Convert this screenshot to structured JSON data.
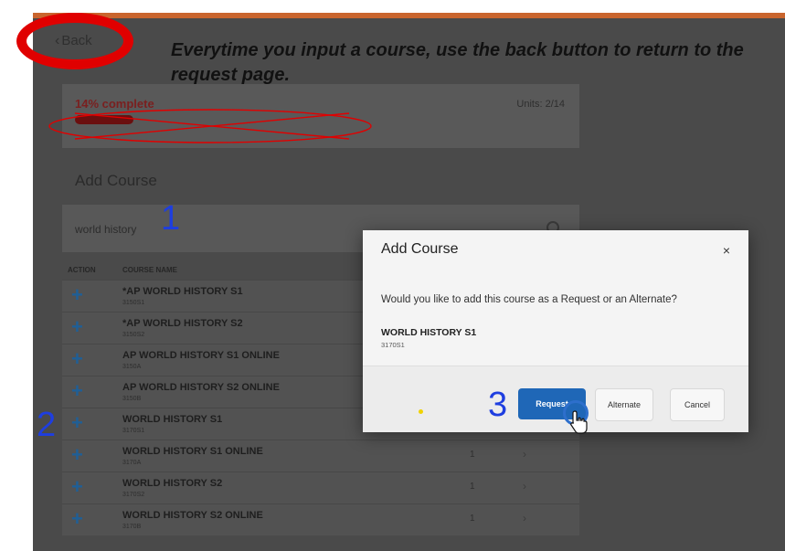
{
  "instruction_text": "Everytime you input a course, use the back button to return to the request page.",
  "header": {
    "back_label": "Back"
  },
  "progress": {
    "label": "14% complete",
    "percent": 14,
    "units_label": "Units: 2/14"
  },
  "add_course": {
    "title": "Add Course",
    "search_value": "world history"
  },
  "table": {
    "headers": {
      "action": "ACTION",
      "course_name": "COURSE NAME"
    },
    "rows": [
      {
        "name": "*AP WORLD HISTORY S1",
        "code": "3150S1",
        "units": "",
        "chevron": false
      },
      {
        "name": "*AP WORLD HISTORY S2",
        "code": "3150S2",
        "units": "",
        "chevron": false
      },
      {
        "name": "AP WORLD HISTORY S1 ONLINE",
        "code": "3150A",
        "units": "",
        "chevron": false
      },
      {
        "name": "AP WORLD HISTORY S2 ONLINE",
        "code": "3150B",
        "units": "",
        "chevron": false
      },
      {
        "name": "WORLD HISTORY S1",
        "code": "3170S1",
        "units": "",
        "chevron": false
      },
      {
        "name": "WORLD HISTORY S1 ONLINE",
        "code": "3170A",
        "units": "1",
        "chevron": true
      },
      {
        "name": "WORLD HISTORY S2",
        "code": "3170S2",
        "units": "1",
        "chevron": true
      },
      {
        "name": "WORLD HISTORY S2 ONLINE",
        "code": "3170B",
        "units": "1",
        "chevron": true
      }
    ]
  },
  "modal": {
    "title": "Add Course",
    "close": "×",
    "question": "Would you like to add this course as a Request or an Alternate?",
    "course_name": "WORLD HISTORY S1",
    "course_code": "3170S1",
    "buttons": {
      "request": "Request",
      "alternate": "Alternate",
      "cancel": "Cancel"
    }
  },
  "annotations": {
    "step1": "1",
    "step2": "2",
    "step3": "3"
  },
  "icons": {
    "plus": "plus-icon",
    "back": "chevron-left-icon",
    "close": "close-icon",
    "row_chevron": "chevron-right-icon",
    "cursor": "hand-pointer-icon"
  },
  "colors": {
    "accent_blue": "#1f67b7",
    "annotation_red": "#e00000",
    "annotation_blue": "#1e3ee0",
    "topbar": "#c9652e"
  }
}
